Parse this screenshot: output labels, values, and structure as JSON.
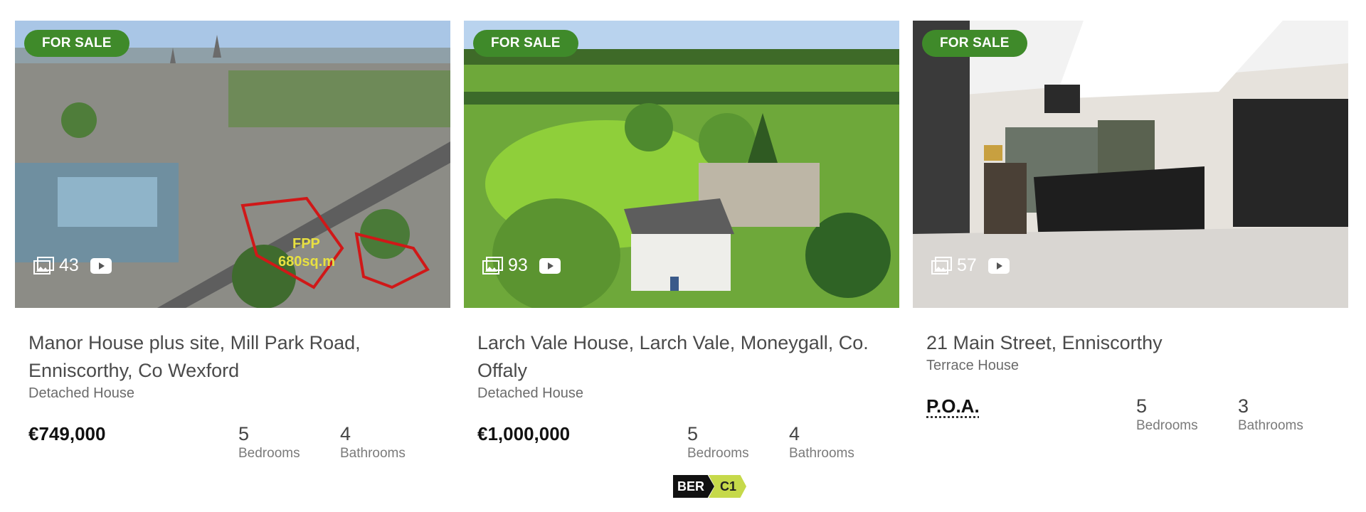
{
  "listings": [
    {
      "status": "FOR SALE",
      "photo_count": "43",
      "title": "Manor House plus site, Mill Park Road, Enniscorthy, Co Wexford",
      "property_type": "Detached House",
      "price": "€749,000",
      "bedrooms": "5",
      "bedrooms_label": "Bedrooms",
      "bathrooms": "4",
      "bathrooms_label": "Bathrooms",
      "overlay_text": [
        "FPP",
        "680sq.m"
      ]
    },
    {
      "status": "FOR SALE",
      "photo_count": "93",
      "title": "Larch Vale House, Larch Vale, Moneygall, Co. Offaly",
      "property_type": "Detached House",
      "price": "€1,000,000",
      "bedrooms": "5",
      "bedrooms_label": "Bedrooms",
      "bathrooms": "4",
      "bathrooms_label": "Bathrooms",
      "ber_label": "BER",
      "ber_rating": "C1"
    },
    {
      "status": "FOR SALE",
      "photo_count": "57",
      "title": "21 Main Street, Enniscorthy",
      "property_type": "Terrace House",
      "price": "P.O.A.",
      "bedrooms": "5",
      "bedrooms_label": "Bedrooms",
      "bathrooms": "3",
      "bathrooms_label": "Bathrooms"
    }
  ],
  "icons": {
    "gallery": "gallery-icon",
    "video": "video-play-icon"
  },
  "colors": {
    "badge": "#3f8a2a",
    "ber_rating": "#c6d94a"
  }
}
